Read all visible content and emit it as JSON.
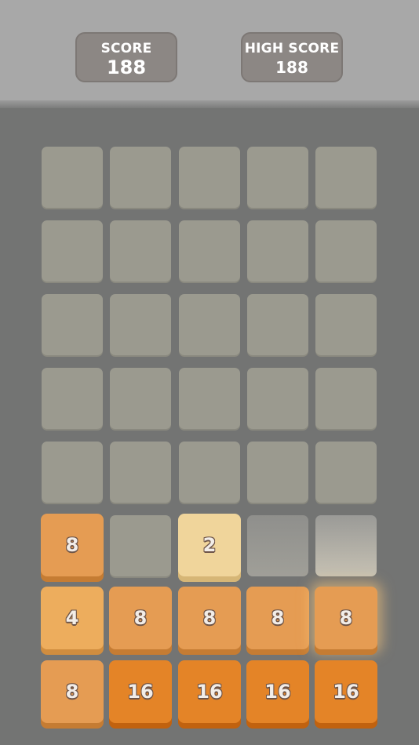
{
  "header": {
    "score_label": "SCORE",
    "score_value": "188",
    "high_score_label": "HIGH SCORE",
    "high_score_value": "188"
  },
  "colors": {
    "background": "#737473",
    "header_background": "#a8a8a8",
    "empty_cell": "#9b9a8f",
    "tile_2": "#f0d59b",
    "tile_4": "#edad5d",
    "tile_8": "#e59c53",
    "tile_16": "#e48427"
  },
  "grid": {
    "columns": 5,
    "rows": 8,
    "tiles": [
      [
        "",
        "",
        "",
        "",
        ""
      ],
      [
        "",
        "",
        "",
        "",
        ""
      ],
      [
        "",
        "",
        "",
        "",
        ""
      ],
      [
        "",
        "",
        "",
        "",
        ""
      ],
      [
        "",
        "",
        "",
        "",
        ""
      ],
      [
        "8",
        "",
        "2",
        "",
        ""
      ],
      [
        "4",
        "8",
        "8",
        "8",
        "8"
      ],
      [
        "8",
        "16",
        "16",
        "16",
        "16"
      ]
    ]
  }
}
